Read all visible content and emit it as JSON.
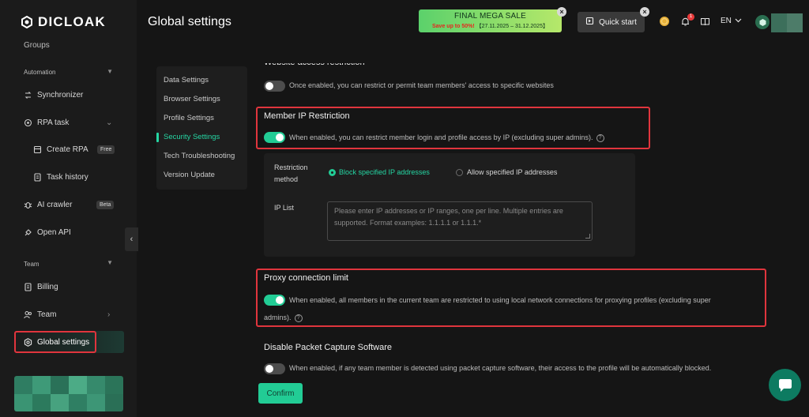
{
  "brand": {
    "name": "DICLOAK"
  },
  "sidebar": {
    "groups_label": "Groups",
    "automation_section": "Automation",
    "items": {
      "synchronizer": "Synchronizer",
      "rpa_task": "RPA task",
      "create_rpa": "Create RPA",
      "create_rpa_badge": "Free",
      "task_history": "Task history",
      "ai_crawler": "AI crawler",
      "ai_crawler_badge": "Beta",
      "open_api": "Open API",
      "billing": "Billing",
      "team": "Team",
      "global_settings": "Global settings"
    },
    "team_section": "Team"
  },
  "header": {
    "title": "Global settings",
    "sale": {
      "title": "FINAL MEGA SALE",
      "highlight": "Save up to 50%!",
      "dates": "【27.11.2025 – 31.12.2025】"
    },
    "quick_start": "Quick start",
    "notification_count": "1",
    "language": "EN"
  },
  "settings_nav": {
    "items": [
      "Data Settings",
      "Browser Settings",
      "Profile Settings",
      "Security Settings",
      "Tech Troubleshooting",
      "Version Update"
    ],
    "active": "Security Settings"
  },
  "content": {
    "website_restriction": {
      "title": "Website access restriction",
      "description": "Once enabled, you can restrict or permit team members' access to specific websites",
      "enabled": false
    },
    "member_ip": {
      "title": "Member IP Restriction",
      "description": "When enabled, you can restrict member login and profile access by IP (excluding super admins).",
      "enabled": true
    },
    "restriction_method": {
      "label_line1": "Restriction",
      "label_line2": "method",
      "options": [
        "Block specified IP addresses",
        "Allow specified IP addresses"
      ],
      "selected": "Block specified IP addresses"
    },
    "ip_list": {
      "label": "IP List",
      "placeholder_line1": "Please enter IP addresses or IP ranges, one per line. Multiple entries are",
      "placeholder_line2": "supported. Format examples: 1.1.1.1 or 1.1.1.*"
    },
    "proxy_limit": {
      "title": "Proxy connection limit",
      "description_line1": "When enabled, all members in the current team are restricted to using local network connections for proxying profiles (excluding super",
      "description_line2": "admins).",
      "enabled": true
    },
    "packet_capture": {
      "title": "Disable Packet Capture Software",
      "description": "When enabled, if any team member is detected using packet capture software, their access to the profile will be automatically blocked.",
      "enabled": false
    },
    "confirm_label": "Confirm"
  },
  "colors": {
    "accent": "#22cc95",
    "highlight_border": "#e0353d",
    "background": "#151515",
    "panel": "#1e1e1e"
  },
  "icons": [
    "logo-icon",
    "sync-icon",
    "rpa-icon",
    "create-rpa-icon",
    "task-history-icon",
    "ai-crawler-icon",
    "open-api-icon",
    "billing-icon",
    "team-icon",
    "gear-icon",
    "quick-start-icon",
    "coin-icon",
    "bell-icon",
    "book-icon",
    "chevron-down-icon",
    "chat-icon",
    "help-icon"
  ]
}
